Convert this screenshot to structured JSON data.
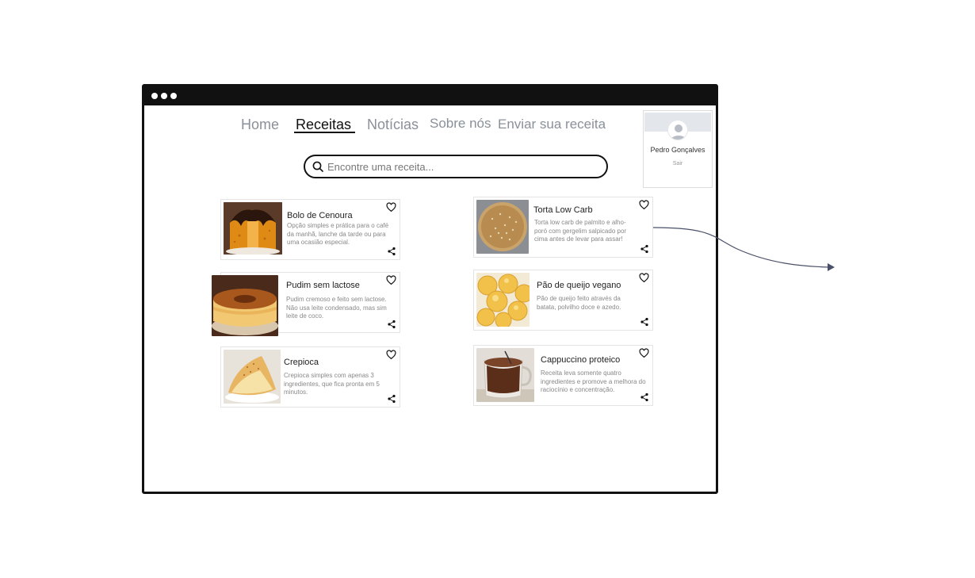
{
  "nav": {
    "items": [
      {
        "label": "Home"
      },
      {
        "label": "Receitas"
      },
      {
        "label": "Notícias"
      },
      {
        "label": "Sobre nós"
      },
      {
        "label": "Enviar sua receita"
      }
    ],
    "active_index": 1
  },
  "search": {
    "placeholder": "Encontre uma receita..."
  },
  "user": {
    "name": "Pedro Gonçalves",
    "logout_label": "Sair"
  },
  "recipes": [
    {
      "title": "Bolo de Cenoura",
      "description": "Opção simples e prática para o café da manhã, lanche da tarde ou para uma ocasião especial.",
      "image": "carrot-cake-image"
    },
    {
      "title": "Torta Low Carb",
      "description": "Torta low carb de palmito e alho-poró com gergelim salpicado por cima antes de levar para assar!",
      "image": "low-carb-pie-image"
    },
    {
      "title": "Pudim sem lactose",
      "description": "Pudim cremoso e feito sem lactose. Não usa leite condensado, mas sim leite de coco.",
      "image": "pudding-image"
    },
    {
      "title": "Pão de queijo vegano",
      "description": "Pão de queijo feito através da batata, polvilho doce e azedo.",
      "image": "cheese-bread-image"
    },
    {
      "title": "Crepioca",
      "description": "Crepioca simples com apenas 3 ingredientes, que fica pronta em 5 minutos.",
      "image": "crepioca-image"
    },
    {
      "title": "Cappuccino proteico",
      "description": "Receita leva somente quatro ingredientes e promove a melhora do raciocínio e concentração.",
      "image": "cappuccino-image"
    }
  ],
  "icons": {
    "favorite": "heart-icon",
    "share": "share-icon",
    "search": "search-icon",
    "avatar": "user-avatar-icon"
  },
  "colors": {
    "frame": "#111111",
    "nav_inactive": "#8a9099",
    "nav_active": "#111111",
    "connector": "#4a5068"
  }
}
